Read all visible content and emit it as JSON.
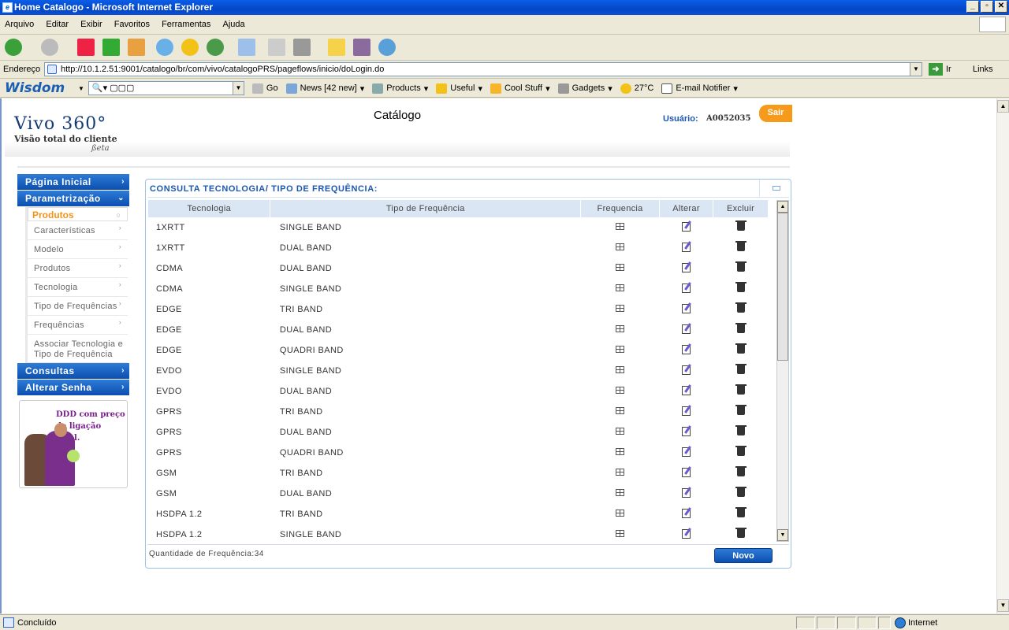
{
  "window": {
    "title": "Home Catalogo - Microsoft Internet Explorer"
  },
  "menu": [
    "Arquivo",
    "Editar",
    "Exibir",
    "Favoritos",
    "Ferramentas",
    "Ajuda"
  ],
  "address": {
    "label": "Endereço",
    "url": "http://10.1.2.51:9001/catalogo/br/com/vivo/catalogoPRS/pageflows/inicio/doLogin.do",
    "go_label": "Ir",
    "links_label": "Links"
  },
  "wisdom": {
    "logo": "Wisdom",
    "search_value": "▢▢▢",
    "go": "Go",
    "news": "News [42 new]",
    "products": "Products",
    "useful": "Useful",
    "cool": "Cool Stuff",
    "gadgets": "Gadgets",
    "temp": "27°C",
    "email": "E-mail Notifier"
  },
  "header": {
    "brand": "Vivo 360°",
    "brand_sub": "Visão total do cliente",
    "brand_beta": "ßeta",
    "title": "Catálogo",
    "user_label": "Usuário:",
    "user_value": "A0052035",
    "logout": "Sair"
  },
  "nav": {
    "home": "Página Inicial",
    "param": "Parametrização",
    "active_sub": "Produtos",
    "subs": [
      "Características",
      "Modelo",
      "Produtos",
      "Tecnologia",
      "Tipo de Frequências",
      "Frequências",
      "Associar Tecnologia e Tipo de Frequência"
    ],
    "consultas": "Consultas",
    "alterar": "Alterar Senha"
  },
  "promo": {
    "text": "DDD com preço de ligação local."
  },
  "panel": {
    "title": "CONSULTA TECNOLOGIA/ TIPO DE FREQUÊNCIA:",
    "columns": [
      "Tecnologia",
      "Tipo de Frequência",
      "Frequencia",
      "Alterar",
      "Excluir"
    ],
    "rows": [
      [
        "1XRTT",
        "SINGLE BAND"
      ],
      [
        "1XRTT",
        "DUAL BAND"
      ],
      [
        "CDMA",
        "DUAL BAND"
      ],
      [
        "CDMA",
        "SINGLE BAND"
      ],
      [
        "EDGE",
        "TRI BAND"
      ],
      [
        "EDGE",
        "DUAL BAND"
      ],
      [
        "EDGE",
        "QUADRI BAND"
      ],
      [
        "EVDO",
        "SINGLE BAND"
      ],
      [
        "EVDO",
        "DUAL BAND"
      ],
      [
        "GPRS",
        "TRI BAND"
      ],
      [
        "GPRS",
        "DUAL BAND"
      ],
      [
        "GPRS",
        "QUADRI BAND"
      ],
      [
        "GSM",
        "TRI BAND"
      ],
      [
        "GSM",
        "DUAL BAND"
      ],
      [
        "HSDPA 1.2",
        "TRI BAND"
      ],
      [
        "HSDPA 1.2",
        "SINGLE BAND"
      ]
    ],
    "quantity": "Quantidade de Frequência:34",
    "new_button": "Novo"
  },
  "status": {
    "text": "Concluído",
    "zone": "Internet"
  },
  "colors": {
    "accent": "#1b57b3",
    "orange": "#f39318",
    "nav_blue": "#0c4fb0"
  }
}
